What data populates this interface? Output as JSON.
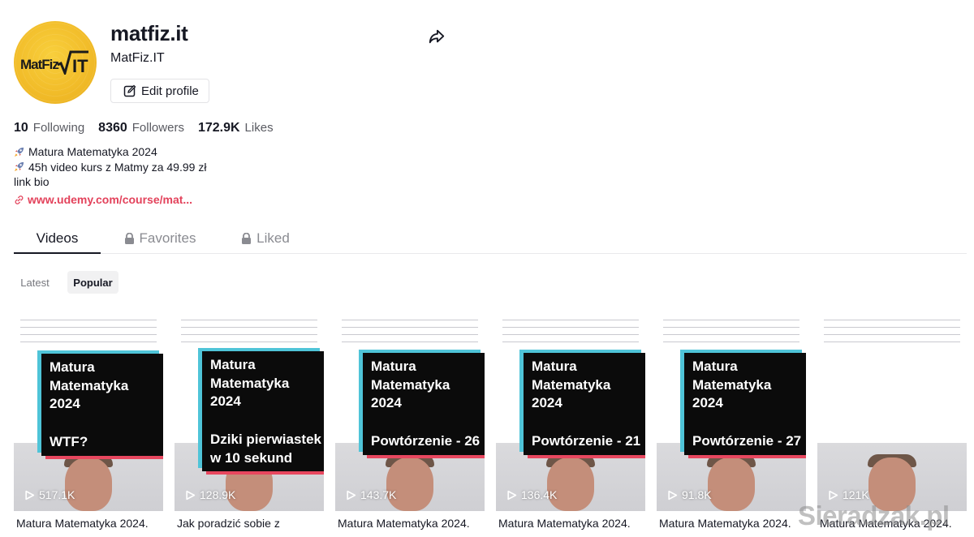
{
  "profile": {
    "avatar_text": "MatFiz√IT",
    "username": "matfiz.it",
    "nickname": "MatFiz.IT",
    "edit_label": "Edit profile",
    "icons": {
      "share": "share-arrow-icon",
      "edit": "edit-icon",
      "link": "link-icon"
    }
  },
  "stats": [
    {
      "value": "10",
      "label": "Following"
    },
    {
      "value": "8360",
      "label": "Followers"
    },
    {
      "value": "172.9K",
      "label": "Likes"
    }
  ],
  "bio": {
    "line1": "Matura Matematyka 2024",
    "line2": "45h video kurs z Matmy za 49.99 zł",
    "line3": "link bio",
    "link": "www.udemy.com/course/mat..."
  },
  "tabs": [
    {
      "label": "Videos",
      "icon": ""
    },
    {
      "label": "Favorites",
      "icon": "lock-icon"
    },
    {
      "label": "Liked",
      "icon": "lock-icon"
    }
  ],
  "filters": {
    "latest": "Latest",
    "popular": "Popular"
  },
  "videos": [
    {
      "sticker_title": "Matura\nMatematyka\n2024",
      "sticker_bottom": "WTF?",
      "views": "517.1K",
      "caption": "Matura Matematyka 2024."
    },
    {
      "sticker_title": "Matura\nMatematyka\n2024",
      "sticker_bottom": "Dziki pierwiastek\nw 10 sekund",
      "views": "128.9K",
      "caption": "Jak poradzić sobie z"
    },
    {
      "sticker_title": "Matura\nMatematyka\n2024",
      "sticker_bottom": "Powtórzenie - 26",
      "views": "143.7K",
      "caption": "Matura Matematyka 2024."
    },
    {
      "sticker_title": "Matura\nMatematyka\n2024",
      "sticker_bottom": "Powtórzenie - 21",
      "views": "136.4K",
      "caption": "Matura Matematyka 2024."
    },
    {
      "sticker_title": "Matura\nMatematyka\n2024",
      "sticker_bottom": "Powtórzenie - 27",
      "views": "91.8K",
      "caption": "Matura Matematyka 2024."
    },
    {
      "sticker_title": "",
      "sticker_bottom": "",
      "views": "121K",
      "caption": "Matura Matematyka 2024."
    }
  ],
  "watermark": "Sieradzak.pl",
  "colors": {
    "accent_link": "#e3425b",
    "sticker_blue": "#4fc4d8",
    "sticker_red": "#e8475f"
  }
}
